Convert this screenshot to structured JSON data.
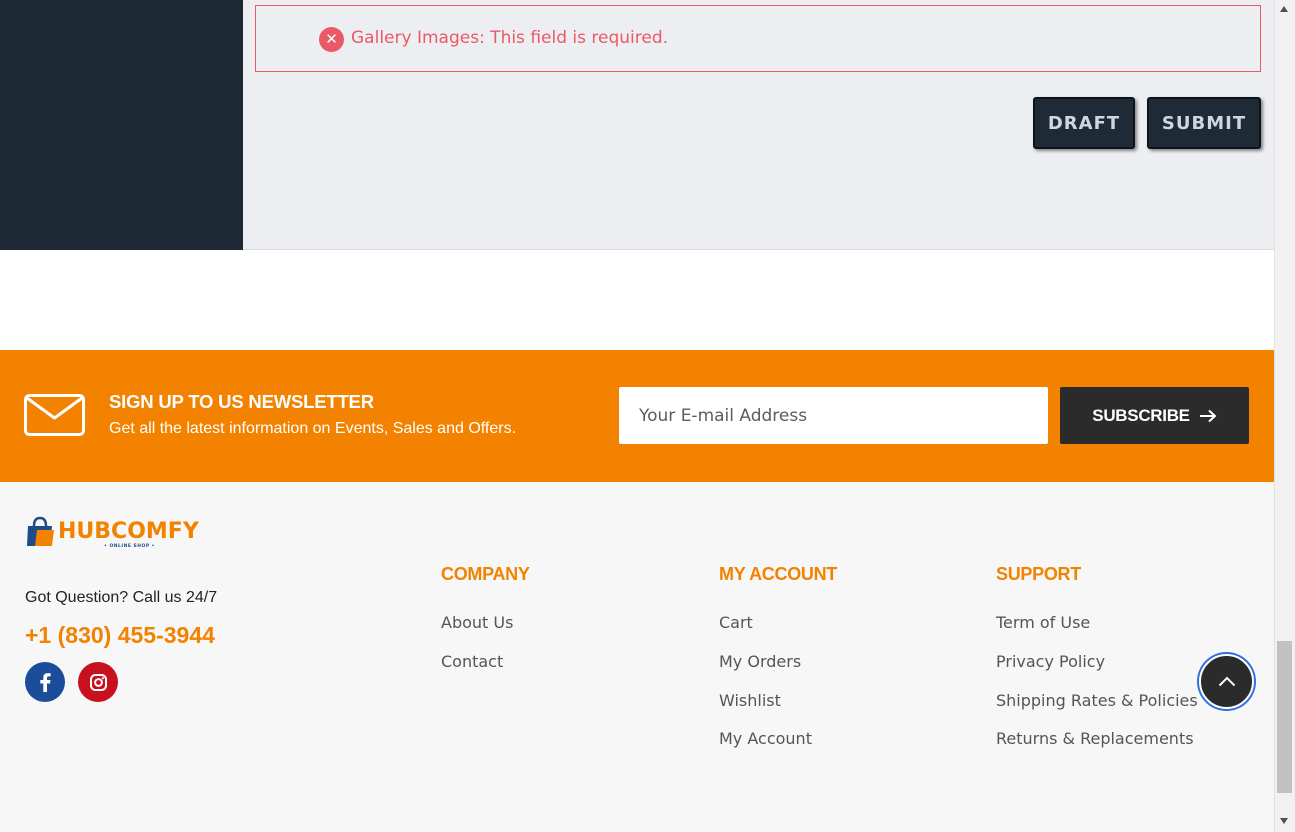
{
  "form": {
    "error_message": "Gallery Images: This field is required.",
    "error_icon": "close-circle-icon",
    "draft_label": "DRAFT",
    "submit_label": "SUBMIT"
  },
  "newsletter": {
    "title": "SIGN UP TO US NEWSLETTER",
    "subtitle": "Get all the latest information on Events, Sales and Offers.",
    "email_placeholder": "Your E-mail Address",
    "subscribe_label": "SUBSCRIBE",
    "icon": "envelope-icon",
    "background_color": "#f28200"
  },
  "footer": {
    "logo_text": "HUBCOMFY",
    "logo_tagline": "• ONLINE SHOP •",
    "question_text": "Got Question? Call us 24/7",
    "phone": "+1 (830) 455-3944",
    "social": [
      "facebook-icon",
      "instagram-icon"
    ],
    "columns": [
      {
        "title": "COMPANY",
        "links": [
          "About Us",
          "Contact"
        ]
      },
      {
        "title": "MY ACCOUNT",
        "links": [
          "Cart",
          "My Orders",
          "Wishlist",
          "My Account"
        ]
      },
      {
        "title": "SUPPORT",
        "links": [
          "Term of Use",
          "Privacy Policy",
          "Shipping Rates & Policies",
          "Returns & Replacements"
        ]
      }
    ],
    "accent_color": "#f28200"
  },
  "scroll_top_icon": "chevron-up-icon"
}
